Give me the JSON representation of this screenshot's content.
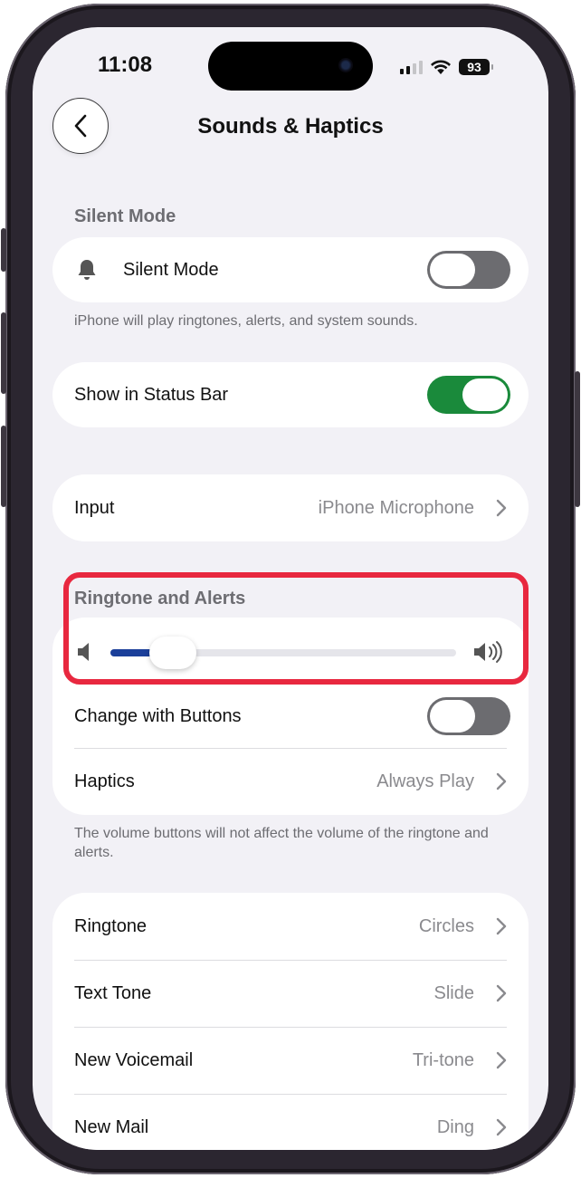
{
  "status_bar": {
    "time": "11:08",
    "battery": "93"
  },
  "nav": {
    "title": "Sounds & Haptics"
  },
  "silent_section": {
    "header": "Silent Mode",
    "row_label": "Silent Mode",
    "toggle_on": false,
    "footnote": "iPhone will play ringtones, alerts, and system sounds."
  },
  "status_bar_row": {
    "label": "Show in Status Bar",
    "toggle_on": true
  },
  "input_row": {
    "label": "Input",
    "value": "iPhone Microphone"
  },
  "ringtone_section": {
    "header": "Ringtone and Alerts",
    "volume_level": 0.18,
    "change_with_buttons": {
      "label": "Change with Buttons",
      "toggle_on": false
    },
    "haptics": {
      "label": "Haptics",
      "value": "Always Play"
    },
    "footnote": "The volume buttons will not affect the volume of the ringtone and alerts."
  },
  "tones": [
    {
      "label": "Ringtone",
      "value": "Circles"
    },
    {
      "label": "Text Tone",
      "value": "Slide"
    },
    {
      "label": "New Voicemail",
      "value": "Tri-tone"
    },
    {
      "label": "New Mail",
      "value": "Ding"
    }
  ],
  "colors": {
    "toggle_on": "#1a8a3b",
    "slider_fill": "#1b3f9a",
    "highlight": "#e8283f"
  }
}
